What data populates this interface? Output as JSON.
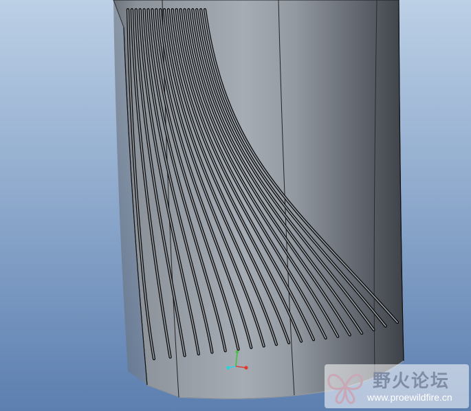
{
  "app": {
    "kind": "3D CAD model viewport"
  },
  "colors": {
    "background_top": "#bcd0e6",
    "background_bottom": "#5c7fb0",
    "model_light": "#a3a9b1",
    "model_dark": "#3e4249",
    "edge": "#0a0a0a"
  },
  "axis_triad": {
    "x_color": "#e03a2e",
    "y_color": "#3ec23e",
    "z_color": "#2fd0e0"
  },
  "watermark": {
    "title": "野火论坛",
    "url": "www.proewildfire.cn",
    "logo_icon": "butterfly-logo-icon"
  }
}
